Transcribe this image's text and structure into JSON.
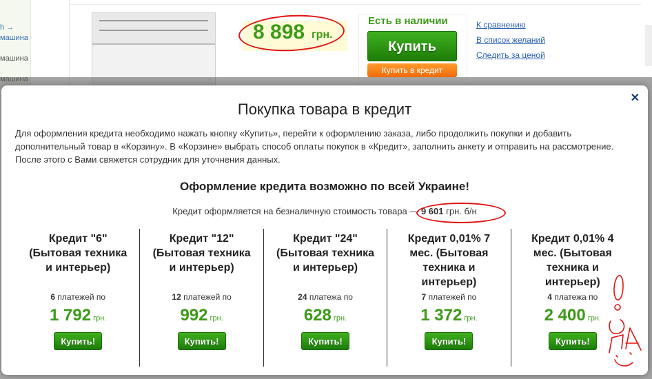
{
  "background": {
    "left_nav": {
      "link_fragment": "h →",
      "items": [
        "машина",
        "машина",
        "машина"
      ]
    },
    "price": {
      "value": "8 898",
      "currency": "грн."
    },
    "availability": "Есть в наличии",
    "buy_label": "Купить",
    "buy_credit_label": "Купить в кредит",
    "links": [
      "К сравнению",
      "В список желаний",
      "Следить за ценой"
    ]
  },
  "modal": {
    "close_glyph": "✕",
    "title": "Покупка товара в кредит",
    "intro": "Для оформления кредита необходимо нажать кнопку «Купить», перейти к оформлению заказа, либо продолжить покупки и добавить дополнительный товар в «Корзину». В «Корзине» выбрать способ оплаты покупок в «Кредит», заполнить анкету и отправить на рассмотрение. После этого с Вами свяжется сотрудник для уточнения данных.",
    "subhead": "Оформление кредита возможно по всей Украине!",
    "credit_note": {
      "prefix": "Кредит оформляется на безналичную стоимость товара — ",
      "amount": "9 601",
      "suffix": " грн. б/н"
    },
    "plans": [
      {
        "title": "Кредит \"6\" (Бытовая техника и интерьер)",
        "count": "6",
        "count_label": " платежей по",
        "amount": "1 792",
        "currency": "грн.",
        "button": "Купить!"
      },
      {
        "title": "Кредит \"12\" (Бытовая техника и интерьер)",
        "count": "12",
        "count_label": " платежей по",
        "amount": "992",
        "currency": "грн.",
        "button": "Купить!"
      },
      {
        "title": "Кредит \"24\" (Бытовая техника и интерьер)",
        "count": "24",
        "count_label": " платежа по",
        "amount": "628",
        "currency": "грн.",
        "button": "Купить!"
      },
      {
        "title": "Кредит 0,01% 7 мес. (Бытовая техника и интерьер)",
        "count": "7",
        "count_label": " платежей по",
        "amount": "1 372",
        "currency": "грн.",
        "button": "Купить!"
      },
      {
        "title": "Кредит 0,01% 4 мес. (Бытовая техника и интерьер)",
        "count": "4",
        "count_label": " платежа по",
        "amount": "2 400",
        "currency": "грн.",
        "button": "Купить!"
      }
    ]
  },
  "annotation": {
    "text": "! ГУД :)",
    "color": "#e01515"
  }
}
